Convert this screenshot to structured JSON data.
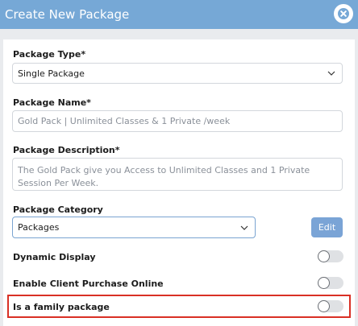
{
  "modal": {
    "title": "Create New Package"
  },
  "form": {
    "package_type": {
      "label": "Package Type*",
      "value": "Single Package"
    },
    "package_name": {
      "label": "Package Name*",
      "placeholder": "Gold Pack | Unlimited Classes & 1 Private /week"
    },
    "package_description": {
      "label": "Package Description*",
      "placeholder": "The Gold Pack give you Access to Unlimited Classes and 1 Private Session Per Week."
    },
    "package_category": {
      "label": "Package Category",
      "value": "Packages",
      "edit_label": "Edit"
    },
    "dynamic_display": {
      "label": "Dynamic Display",
      "enabled": false
    },
    "enable_client_purchase_online": {
      "label": "Enable Client Purchase Online",
      "enabled": false
    },
    "is_family_package": {
      "label": "Is a family package",
      "enabled": false,
      "highlighted": true
    }
  },
  "colors": {
    "header_bg": "#76a8d6",
    "edit_button_bg": "#7aa4d6",
    "highlight_border": "#d93025"
  }
}
